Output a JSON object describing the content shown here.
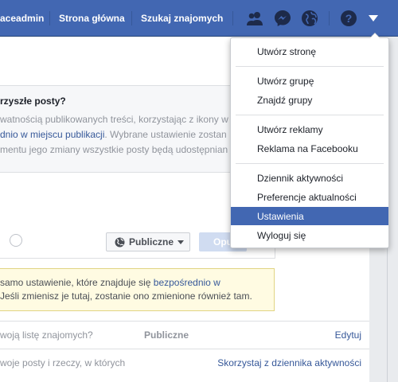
{
  "topbar": {
    "nav_user": "aceadmin",
    "nav_home": "Strona główna",
    "nav_find_friends": "Szukaj znajomych",
    "icons": [
      "friends-icon",
      "messenger-icon",
      "notifications-icon",
      "help-icon",
      "account-menu-icon"
    ],
    "colors": {
      "bar": "#4267b2",
      "active_item": "#4267b2"
    }
  },
  "dropdown": {
    "groups": [
      [
        "Utwórz stronę"
      ],
      [
        "Utwórz grupę",
        "Znajdź grupy"
      ],
      [
        "Utwórz reklamy",
        "Reklama na Facebooku"
      ],
      [
        "Dziennik aktywności",
        "Preferencje aktualności",
        "Ustawienia",
        "Wyloguj się"
      ]
    ],
    "active": "Ustawienia"
  },
  "privacy": {
    "title": "rzyszłe posty?",
    "line1": "watnością publikowanych treści, korzystając z ikony w",
    "line2_link": "dnio w miejscu publikacji",
    "line2_rest": ". Wybrane ustawienie zostan",
    "line3": "mentu jego zmiany wszystkie posty będą udostępnian",
    "audience_label": "Publiczne",
    "publish_label": "Opu"
  },
  "warning": {
    "line1_pre": "samo ustawienie, które znajduje się ",
    "line1_link": "bezpośrednio w",
    "line2": "Jeśli zmienisz je tutaj, zostanie ono zmienione również tam."
  },
  "rows": [
    {
      "question": "woją listę znajomych?",
      "value": "Publiczne",
      "action": "Edytuj"
    },
    {
      "question": "woje posty i rzeczy, w których",
      "value": "",
      "action": "Skorzystaj z dziennika aktywności"
    }
  ]
}
